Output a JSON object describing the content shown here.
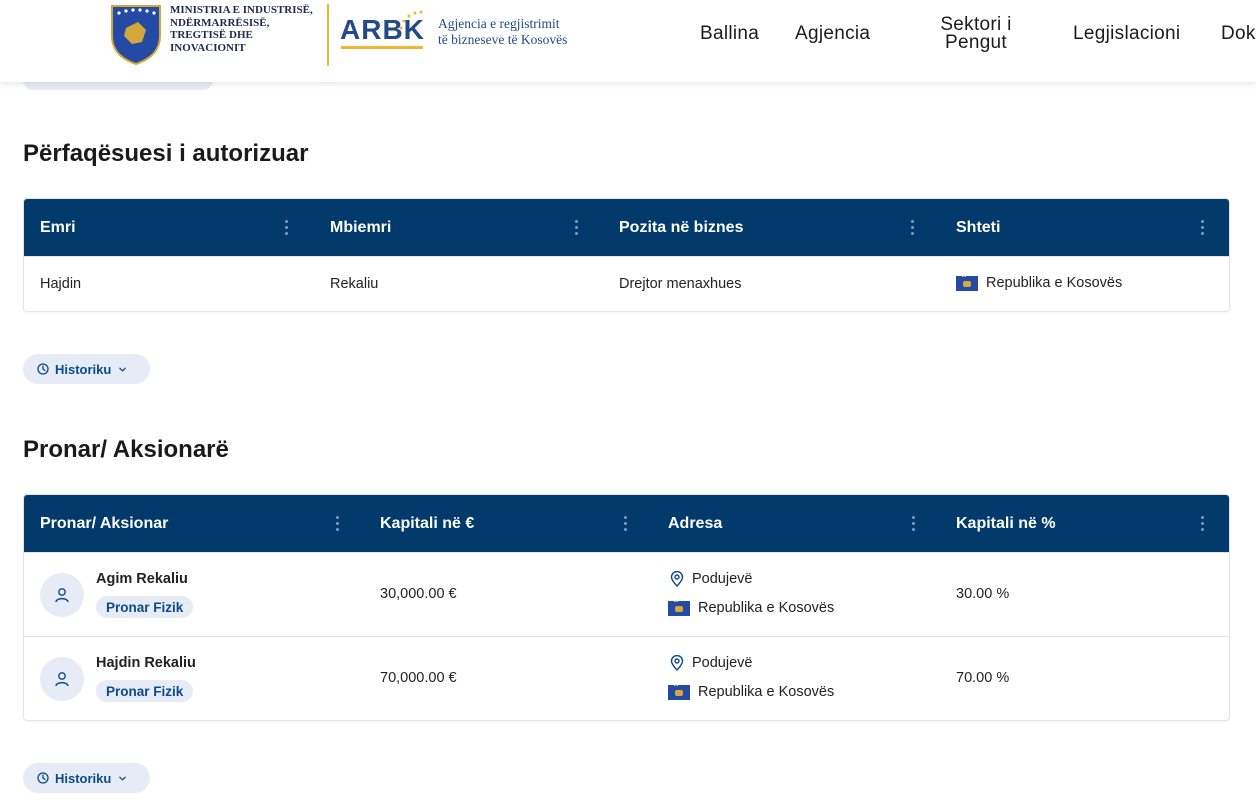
{
  "header": {
    "ministry_lines": [
      "MINISTRIA E INDUSTRISË,",
      "NDËRMARRËSISË,",
      "TREGTISË DHE",
      "INOVACIONIT"
    ],
    "arbk_logo_text": "ARBK",
    "agency_lines": [
      "Agjencia e regjistrimit",
      "të bizneseve të Kosovës"
    ],
    "nav": [
      "Ballina",
      "Agjencia",
      "Sektori i Pengut",
      "Legjislacioni",
      "Dok"
    ]
  },
  "representative": {
    "title": "Përfaqësuesi i autorizuar",
    "columns": [
      "Emri",
      "Mbiemri",
      "Pozita në biznes",
      "Shteti"
    ],
    "rows": [
      {
        "emri": "Hajdin",
        "mbiemri": "Rekaliu",
        "pozita": "Drejtor menaxhues",
        "shteti": "Republika e Kosovës"
      }
    ],
    "history_label": "Historiku"
  },
  "owners": {
    "title": "Pronar/ Aksionarë",
    "columns": [
      "Pronar/ Aksionar",
      "Kapitali në €",
      "Adresa",
      "Kapitali në %"
    ],
    "rows": [
      {
        "name": "Agim Rekaliu",
        "type": "Pronar Fizik",
        "capital": "30,000.00 €",
        "city": "Podujevë",
        "country": "Republika e Kosovës",
        "percent": "30.00 %"
      },
      {
        "name": "Hajdin Rekaliu",
        "type": "Pronar Fizik",
        "capital": "70,000.00 €",
        "city": "Podujevë",
        "country": "Republika e Kosovës",
        "percent": "70.00 %"
      }
    ],
    "history_label": "Historiku"
  },
  "icons": {
    "kebab": "kebab-vertical-icon",
    "clock": "clock-icon",
    "chevron": "chevron-down-icon",
    "user": "user-icon",
    "pin": "map-pin-icon",
    "flag": "kosovo-flag-icon"
  },
  "colors": {
    "table_header": "#013a6b",
    "accent_blue": "#0b4a8c",
    "pill_bg": "#e6ebf5",
    "logo_gold": "#f2b631"
  }
}
